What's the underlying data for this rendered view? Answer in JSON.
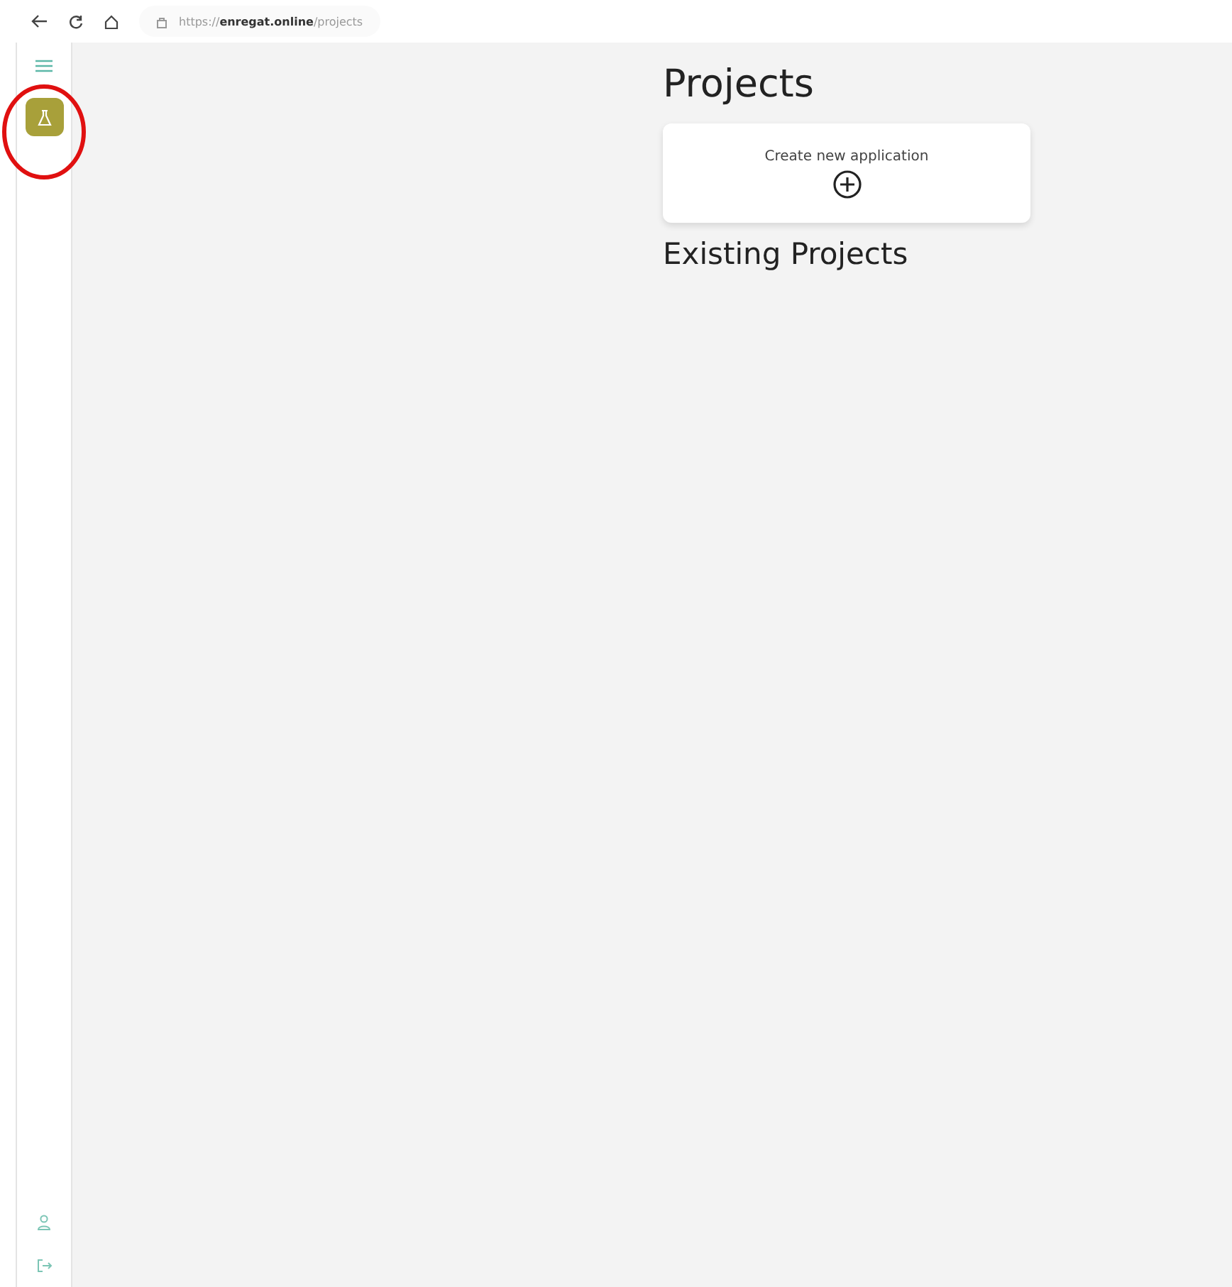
{
  "browser": {
    "url": "https://**enregat.online**/projects"
  },
  "sidebar": {
    "items": [
      {
        "kind": "app",
        "selected": true
      }
    ]
  },
  "page": {
    "title": "Projects",
    "create_card": {
      "label": "Create new application"
    },
    "section_title": "Existing Projects"
  }
}
